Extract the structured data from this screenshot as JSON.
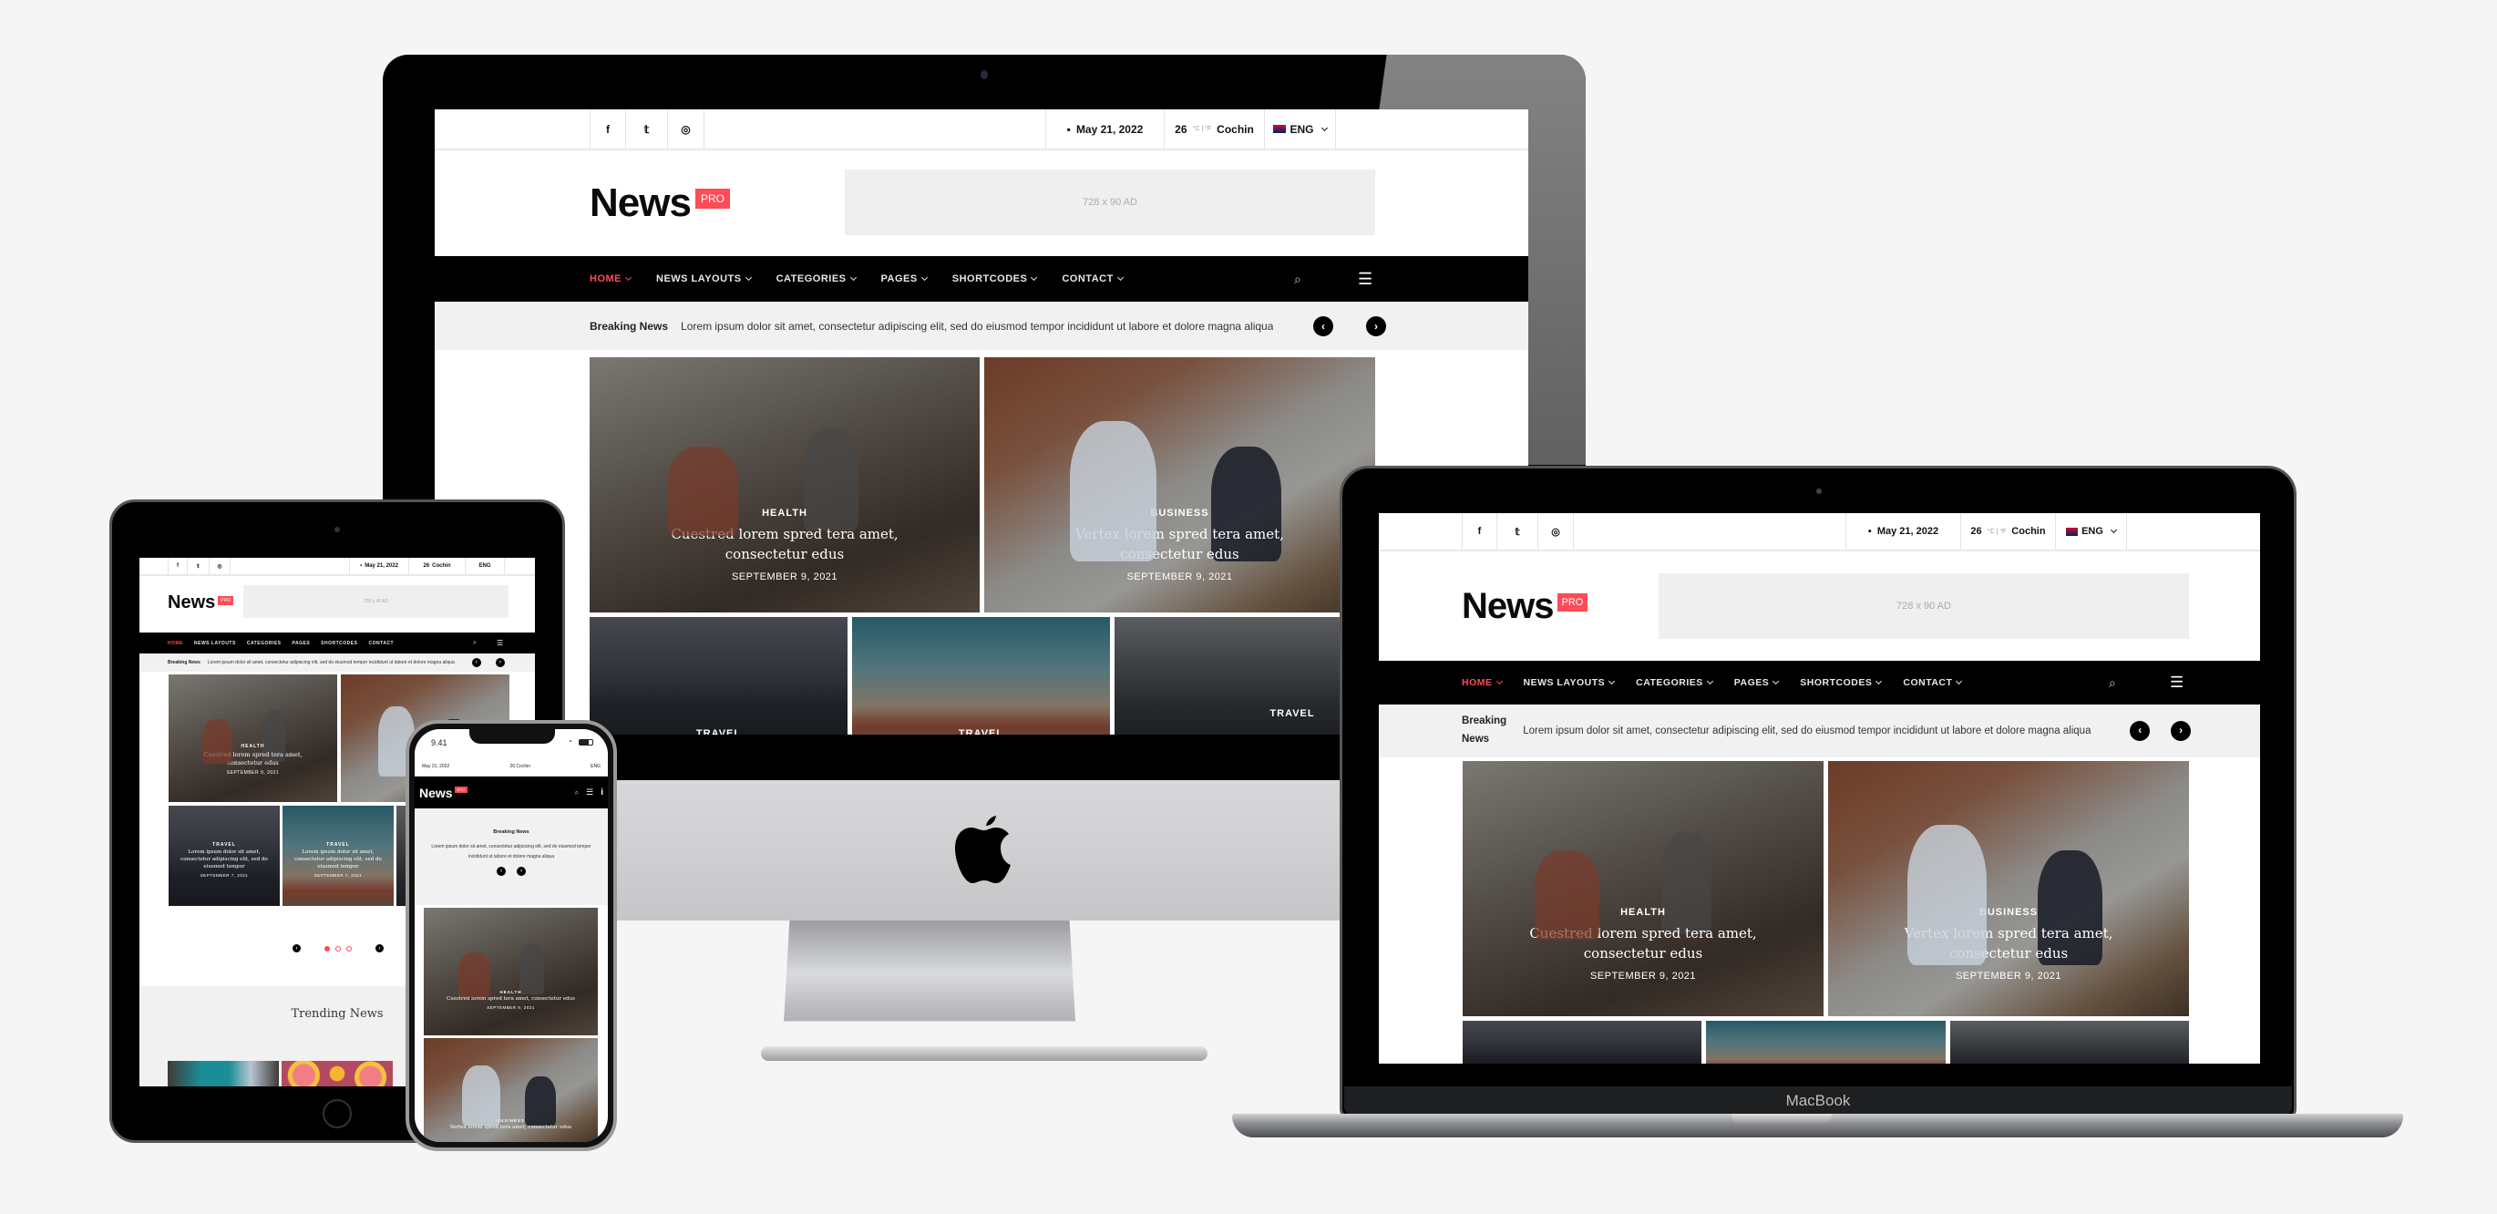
{
  "brand": {
    "name": "News",
    "badge": "PRO",
    "accent": "#ff4b55"
  },
  "topbar": {
    "social": [
      "facebook-icon",
      "twitter-icon",
      "instagram-icon"
    ],
    "social_glyphs": [
      "f",
      "𝕥",
      "◎"
    ],
    "date": "May 21, 2022",
    "temperature": "26",
    "temp_units": "°C | °F",
    "city": "Cochin",
    "language": "ENG"
  },
  "ad": {
    "label": "728 x 90 AD"
  },
  "nav": {
    "items": [
      {
        "label": "HOME",
        "active": true
      },
      {
        "label": "NEWS LAYOUTS",
        "active": false
      },
      {
        "label": "CATEGORIES",
        "active": false
      },
      {
        "label": "PAGES",
        "active": false
      },
      {
        "label": "SHORTCODES",
        "active": false
      },
      {
        "label": "CONTACT",
        "active": false
      }
    ]
  },
  "ticker": {
    "label": "Breaking News",
    "label_line1": "Breaking",
    "label_line2": "News",
    "text": "Lorem ipsum dolor sit amet, consectetur adipiscing elit, sed do eiusmod tempor incididunt ut labore et dolore magna aliqua",
    "prev": "‹",
    "next": "›"
  },
  "featured": [
    {
      "category": "HEALTH",
      "title": "Cuestred lorem spred tera amet, consectetur edus",
      "date": "SEPTEMBER 9, 2021"
    },
    {
      "category": "BUSINESS",
      "title": "Vertex lorem spred tera amet, consectetur edus",
      "date": "SEPTEMBER 9, 2021"
    }
  ],
  "secondary": [
    {
      "category": "TRAVEL",
      "title": "Lorem ipsum dolor sit amet, consectetur adipiscing elit, sed do eiusmod tempor",
      "date": "SEPTEMBER 7, 2021"
    },
    {
      "category": "TRAVEL",
      "title": "Lorem ipsum dolor sit amet, consectetur adipiscing elit, sed do eiusmod tempor",
      "date": "SEPTEMBER 7, 2021"
    },
    {
      "category": "TRAVEL",
      "title": "",
      "date": ""
    }
  ],
  "slider": {
    "dots": 3,
    "active_dot": 1
  },
  "trending": {
    "title": "Trending News"
  },
  "phone": {
    "time": "9.41"
  },
  "devices": {
    "laptop_label": "MacBook"
  }
}
